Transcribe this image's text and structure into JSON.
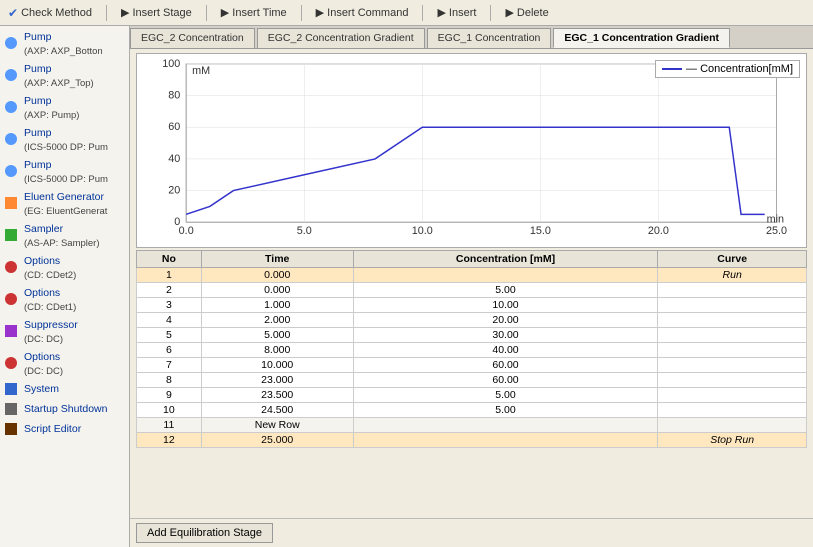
{
  "toolbar": {
    "items": [
      {
        "label": "Check Method",
        "icon": "✔"
      },
      {
        "label": "Insert Stage",
        "icon": "▶"
      },
      {
        "label": "Insert Time",
        "icon": "▶"
      },
      {
        "label": "Insert Command",
        "icon": "▶"
      },
      {
        "label": "Insert",
        "icon": "▶"
      },
      {
        "label": "Delete",
        "icon": "▶"
      }
    ]
  },
  "sidebar": {
    "items": [
      {
        "label": "Pump",
        "sub": "(AXP: AXP_Botton",
        "icon": "pump"
      },
      {
        "label": "Pump",
        "sub": "(AXP: AXP_Top)",
        "icon": "pump"
      },
      {
        "label": "Pump",
        "sub": "(AXP: Pump)",
        "icon": "pump"
      },
      {
        "label": "Pump",
        "sub": "(ICS-5000 DP: Pum",
        "icon": "pump"
      },
      {
        "label": "Pump",
        "sub": "(ICS-5000 DP: Pum",
        "icon": "pump"
      },
      {
        "label": "Eluent Generator",
        "sub": "(EG: EluentGenerat",
        "icon": "eluent"
      },
      {
        "label": "Sampler",
        "sub": "(AS-AP: Sampler)",
        "icon": "sampler"
      },
      {
        "label": "Options",
        "sub": "(CD: CDet2)",
        "icon": "options"
      },
      {
        "label": "Options",
        "sub": "(CD: CDet1)",
        "icon": "options"
      },
      {
        "label": "Suppressor",
        "sub": "(DC: DC)",
        "icon": "suppressor"
      },
      {
        "label": "Options",
        "sub": "(DC: DC)",
        "icon": "options"
      },
      {
        "label": "System",
        "sub": "",
        "icon": "system"
      },
      {
        "label": "Startup Shutdown",
        "sub": "",
        "icon": "startup"
      },
      {
        "label": "Script Editor",
        "sub": "",
        "icon": "script"
      }
    ]
  },
  "tabs": [
    {
      "label": "EGC_2 Concentration",
      "active": false
    },
    {
      "label": "EGC_2 Concentration Gradient",
      "active": false
    },
    {
      "label": "EGC_1 Concentration",
      "active": false
    },
    {
      "label": "EGC_1 Concentration Gradient",
      "active": true
    }
  ],
  "chart": {
    "yLabel": "mM",
    "xMin": 0,
    "xMax": 25.0,
    "yMin": 0,
    "yMax": 100,
    "xTicks": [
      "0.0",
      "5.0",
      "10.0",
      "15.0",
      "20.0",
      "25.0"
    ],
    "yTicks": [
      "0",
      "20",
      "40",
      "60",
      "80",
      "100"
    ],
    "xAxisLabel": "min",
    "legend": "— Concentration[mM]"
  },
  "table": {
    "headers": [
      "No",
      "Time",
      "Concentration [mM]",
      "Curve"
    ],
    "rows": [
      {
        "no": "1",
        "time": "0.000",
        "conc": "",
        "curve": "Run",
        "highlight": true
      },
      {
        "no": "2",
        "time": "0.000",
        "conc": "5.00",
        "curve": "",
        "highlight": false
      },
      {
        "no": "3",
        "time": "1.000",
        "conc": "10.00",
        "curve": "",
        "highlight": false
      },
      {
        "no": "4",
        "time": "2.000",
        "conc": "20.00",
        "curve": "",
        "highlight": false
      },
      {
        "no": "5",
        "time": "5.000",
        "conc": "30.00",
        "curve": "",
        "highlight": false
      },
      {
        "no": "6",
        "time": "8.000",
        "conc": "40.00",
        "curve": "",
        "highlight": false
      },
      {
        "no": "7",
        "time": "10.000",
        "conc": "60.00",
        "curve": "",
        "highlight": false
      },
      {
        "no": "8",
        "time": "23.000",
        "conc": "60.00",
        "curve": "",
        "highlight": false
      },
      {
        "no": "9",
        "time": "23.500",
        "conc": "5.00",
        "curve": "",
        "highlight": false
      },
      {
        "no": "10",
        "time": "24.500",
        "conc": "5.00",
        "curve": "",
        "highlight": false
      },
      {
        "no": "11",
        "time": "New Row",
        "conc": "",
        "curve": "",
        "highlight": false,
        "newrow": true
      },
      {
        "no": "12",
        "time": "25.000",
        "conc": "",
        "curve": "Stop Run",
        "highlight": true
      }
    ]
  },
  "footer": {
    "button": "Add Equilibration Stage"
  }
}
